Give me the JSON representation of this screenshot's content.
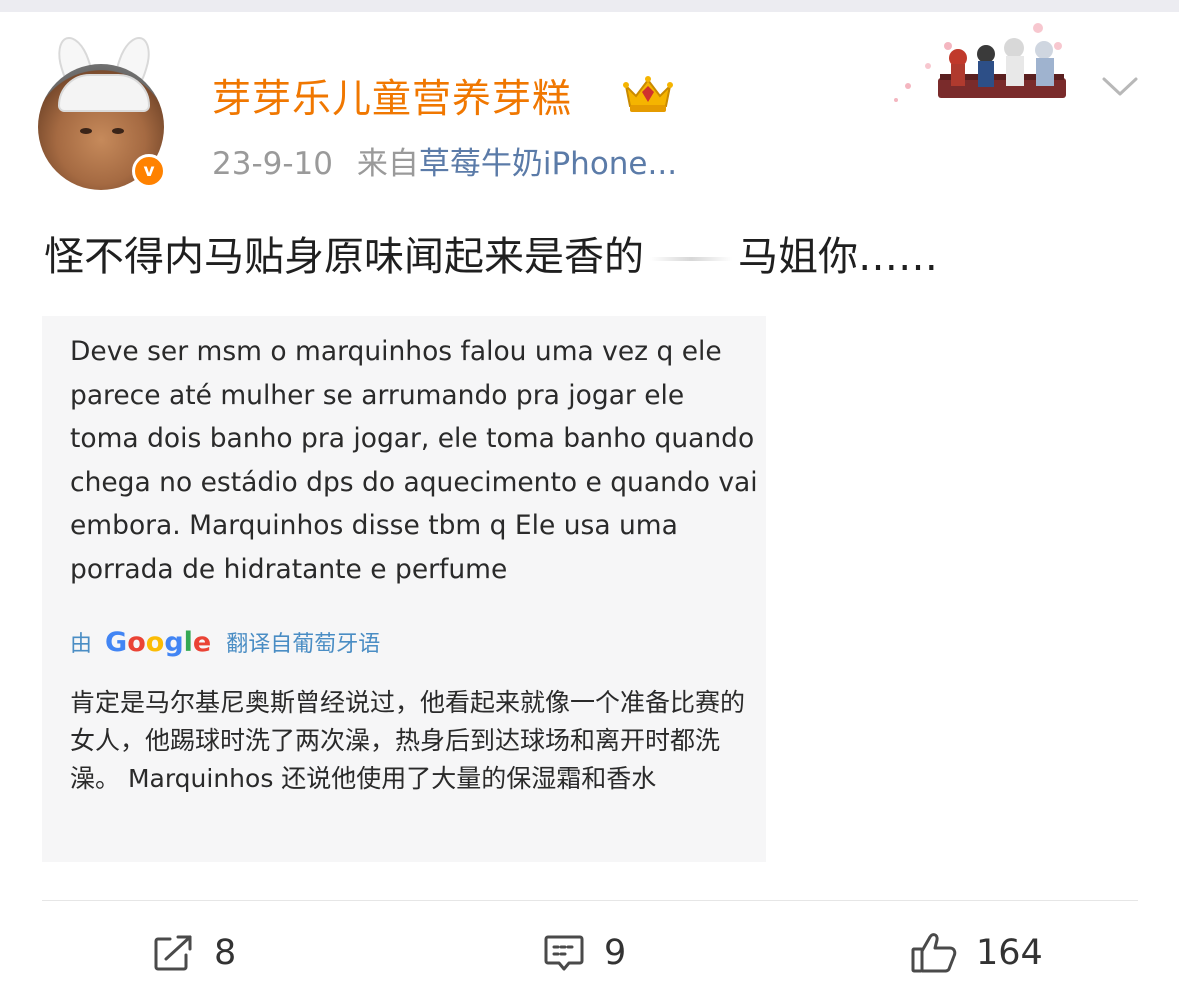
{
  "post": {
    "username": "芽芽乐儿童营养芽糕",
    "date": "23-9-10",
    "from_label": "来自",
    "source": "草莓牛奶iPhone...",
    "text_part1": "怪不得内马贴身原味闻起来是香的",
    "text_part2": "马姐你……",
    "verified_badge": "v"
  },
  "attachment": {
    "original_text": "Deve ser msm o marquinhos falou uma vez q ele parece até mulher se arrumando pra jogar ele toma dois banho pra jogar, ele toma banho quando chega no estádio dps do aquecimento e quando vai embora. Marquinhos disse tbm q Ele usa uma porrada de hidratante e perfume",
    "translate_prefix": "由",
    "translate_brand": "Google",
    "translate_suffix": "翻译自葡萄牙语",
    "translated_text": "肯定是马尔基尼奥斯曾经说过，他看起来就像一个准备比赛的女人，他踢球时洗了两次澡，热身后到达球场和离开时都洗澡。 Marquinhos 还说他使用了大量的保湿霜和香水"
  },
  "actions": {
    "repost_count": "8",
    "comment_count": "9",
    "like_count": "164"
  },
  "icons": {
    "repost": "repost-icon",
    "comment": "comment-icon",
    "like": "thumbs-up-icon",
    "more": "chevron-down-icon",
    "member": "crown-icon"
  },
  "colors": {
    "username": "#f07700",
    "source_link": "#5b7ba8",
    "verified": "#ff8200",
    "translate": "#4a8dc4"
  }
}
